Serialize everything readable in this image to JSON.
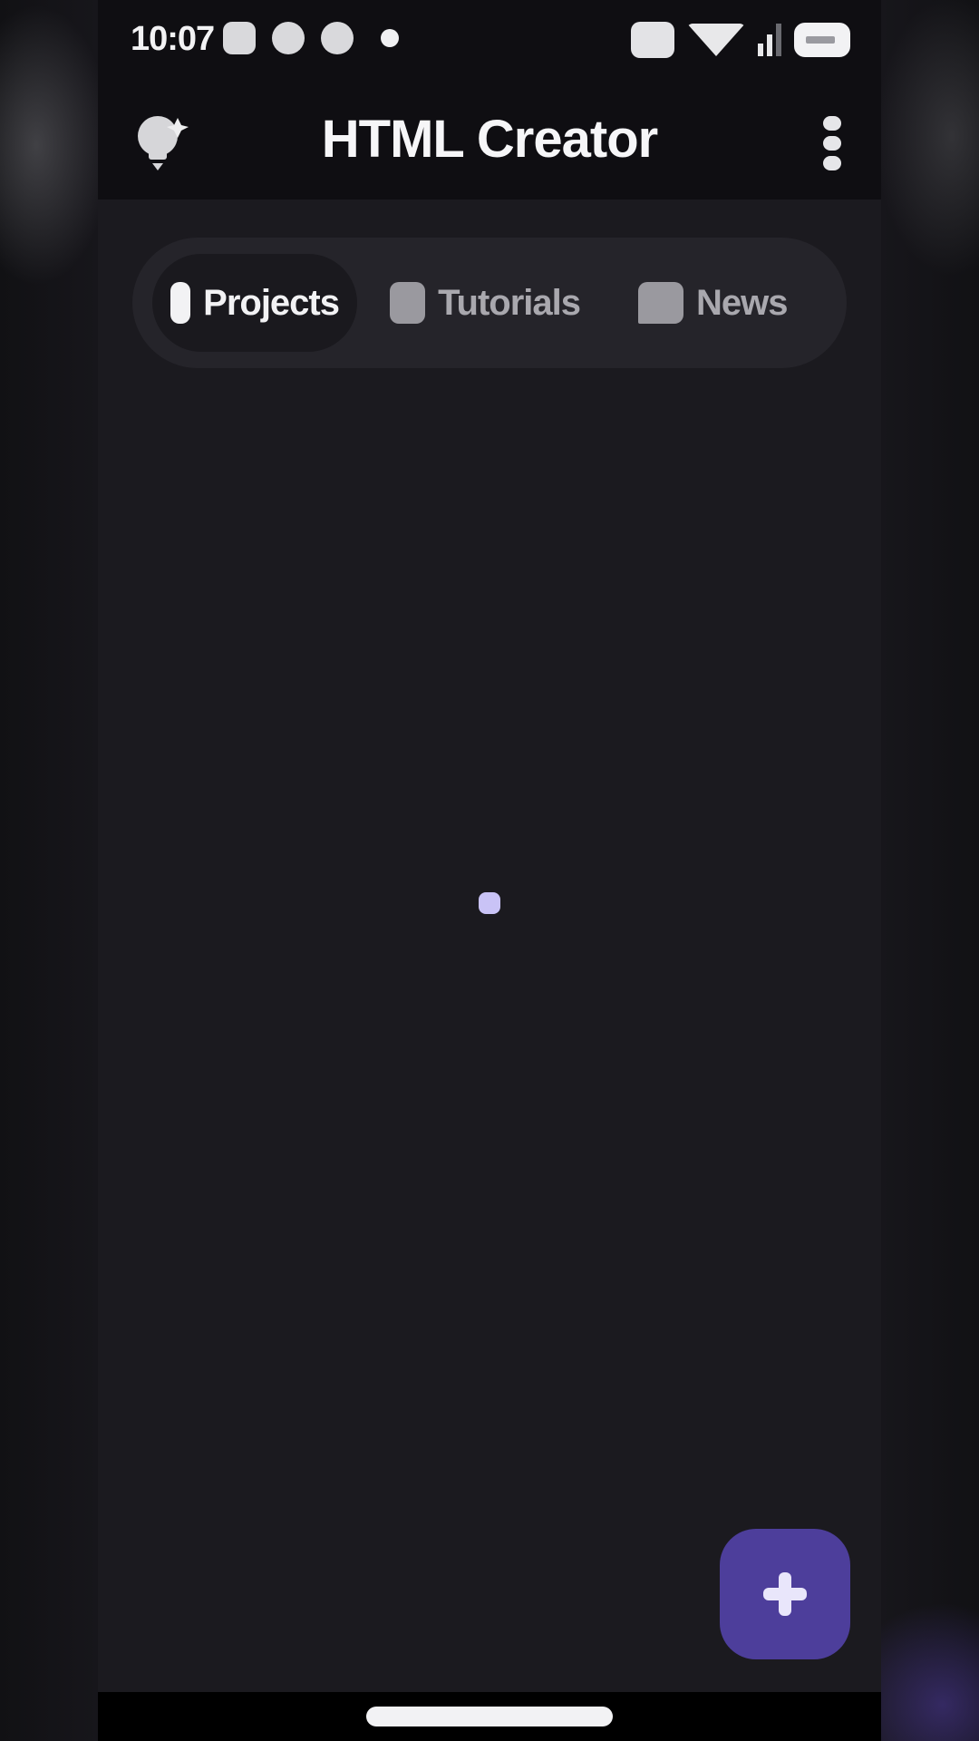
{
  "status_bar": {
    "time": "10:07",
    "icons": [
      "image-notification-icon",
      "app-notification-icon",
      "app-notification-icon",
      "dot-icon",
      "network-icon",
      "wifi-icon",
      "signal-icon",
      "battery-icon"
    ]
  },
  "app_bar": {
    "title": "HTML Creator",
    "left_icon": "lightbulb-icon",
    "right_icon": "more-vert-icon"
  },
  "tabs": [
    {
      "label": "Projects",
      "icon": "folder-icon",
      "active": true
    },
    {
      "label": "Tutorials",
      "icon": "book-icon",
      "active": false
    },
    {
      "label": "News",
      "icon": "chat-icon",
      "active": false
    }
  ],
  "fab": {
    "icon": "plus-icon"
  },
  "colors": {
    "background": "#1b1a1f",
    "app_bar": "#0f0e12",
    "tab_strip": "#25242a",
    "accent": "#4d3e9b",
    "spinner": "#c9c3f6"
  }
}
